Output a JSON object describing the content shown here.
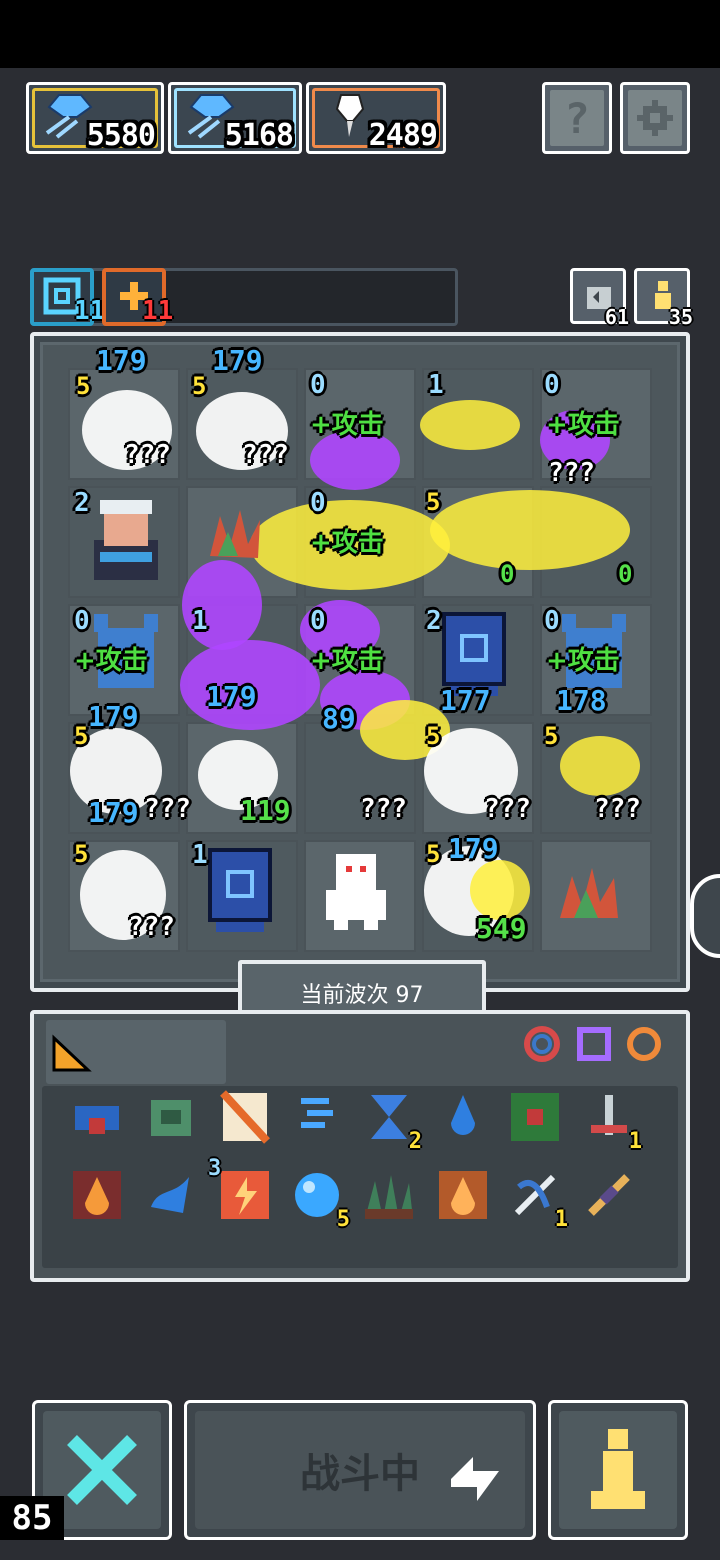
{
  "resources": [
    {
      "icon": "blue-crystal-icon",
      "value": "5580",
      "border": "#e6c23a"
    },
    {
      "icon": "blue-crystal-icon",
      "value": "5168",
      "border": "#9fe2ff"
    },
    {
      "icon": "white-sword-icon",
      "value": "2489",
      "border": "#f08a4b"
    }
  ],
  "help_button": "?",
  "buffs": {
    "spiral": "11",
    "fire": "11"
  },
  "timers": {
    "hourglass": "61",
    "person": "35"
  },
  "board": {
    "wave_label": "当前波次 97",
    "texts": {
      "t1": "179",
      "t2": "5",
      "t3": "???",
      "t4": "5",
      "t5": "179",
      "t6": "???",
      "t7": "0",
      "t8": "+攻击",
      "t9": "1",
      "t10": "0",
      "t11": "+攻击",
      "t12": "???",
      "t13": "2",
      "t14": "0",
      "t15": "+攻击",
      "t16": "5",
      "t17": "0",
      "t18": "0",
      "t19": "0",
      "t20": "+攻击",
      "t21": "179",
      "t22": "1",
      "t23": "179",
      "t24": "0",
      "t25": "+攻击",
      "t26": "89",
      "t27": "2",
      "t28": "177",
      "t29": "0",
      "t30": "+攻击",
      "t31": "178",
      "t32": "5",
      "t33": "179",
      "t34": "???",
      "t35": "119",
      "t36": "???",
      "t37": "5",
      "t38": "???",
      "t39": "5",
      "t40": "???",
      "t41": "5",
      "t42": "???",
      "t43": "1",
      "t44": "5",
      "t45": "179",
      "t46": "549"
    }
  },
  "inventory": {
    "counts": {
      "hourglass": "2",
      "anchor": "1",
      "bubble": "5",
      "rune": "3",
      "bow": "1"
    }
  },
  "bottom": {
    "battle": "战斗中",
    "fps": "85"
  }
}
